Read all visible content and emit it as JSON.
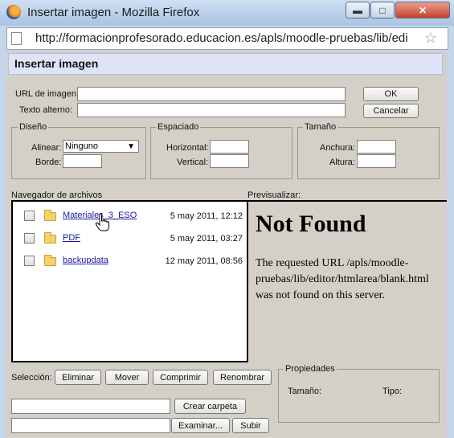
{
  "window": {
    "title": "Insertar imagen - Mozilla Firefox",
    "url": "http://formacionprofesorado.educacion.es/apls/moodle-pruebas/lib/edi",
    "buttons": {
      "minimize": "▬",
      "maximize": "□",
      "close": "✕"
    }
  },
  "dialog": {
    "header": "Insertar imagen",
    "url_label": "URL de imagen:",
    "url_value": "",
    "alt_label": "Texto alterno:",
    "alt_value": "",
    "ok_label": "OK",
    "cancel_label": "Cancelar"
  },
  "layout_group": {
    "legend": "Diseño",
    "align_label": "Alinear:",
    "align_value": "Ninguno",
    "border_label": "Borde:",
    "border_value": ""
  },
  "spacing_group": {
    "legend": "Espaciado",
    "horizontal_label": "Horizontal:",
    "vertical_label": "Vertical:"
  },
  "size_group": {
    "legend": "Tamaño",
    "width_label": "Anchura:",
    "height_label": "Altura:"
  },
  "file_browser": {
    "label": "Navegador de archivos",
    "items": [
      {
        "name": "Materiales_3_ESO",
        "date": "5 may 2011, 12:12"
      },
      {
        "name": "PDF",
        "date": "5 may 2011, 03:27"
      },
      {
        "name": "backupdata",
        "date": "12 may 2011, 08:56"
      }
    ]
  },
  "preview": {
    "label": "Previsualizar:",
    "title": "Not Found",
    "message": "The requested URL /apls/moodle-pruebas/lib/editor/htmlarea/blank.html was not found on this server."
  },
  "selection": {
    "label": "Selección:",
    "delete": "Eliminar",
    "move": "Mover",
    "zip": "Comprimir",
    "rename": "Renombrar"
  },
  "actions": {
    "create_folder": "Crear carpeta",
    "browse": "Examinar...",
    "upload": "Subir"
  },
  "properties": {
    "legend": "Propiedades",
    "size_label": "Tamaño:",
    "type_label": "Tipo:"
  }
}
